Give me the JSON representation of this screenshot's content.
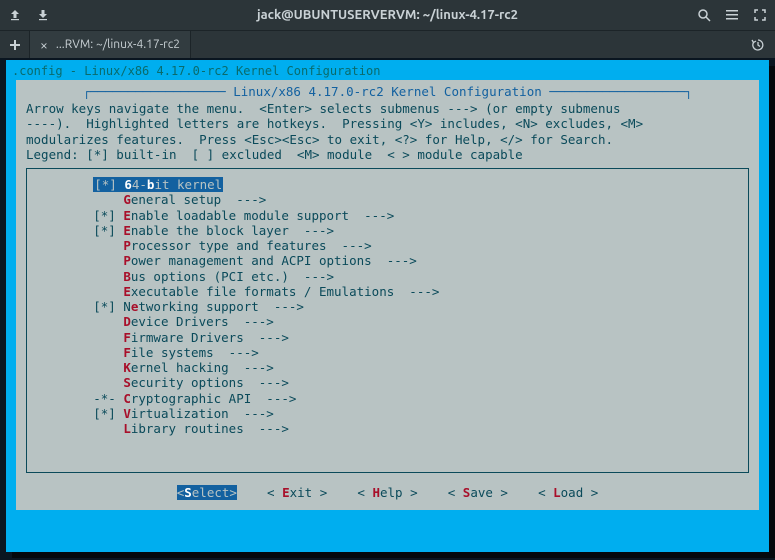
{
  "window": {
    "title": "jack@UBUNTUSERVERVM: ~/linux-4.17-rc2",
    "tab_label": "...RVM: ~/linux-4.17-rc2"
  },
  "config_header": ".config - Linux/x86 4.17.0-rc2 Kernel Configuration",
  "dialog": {
    "title": " Linux/x86 4.17.0-rc2 Kernel Configuration ",
    "help1": "Arrow keys navigate the menu.  <Enter> selects submenus ---> (or empty submenus",
    "help2": "----).  Highlighted letters are hotkeys.  Pressing <Y> includes, <N> excludes, <M>",
    "help3": "modularizes features.  Press <Esc><Esc> to exit, <?> for Help, </> for Search.",
    "help4": "Legend: [*] built-in  [ ] excluded  <M> module  < > module capable"
  },
  "menu": [
    {
      "prefix": "[*] ",
      "hot": "6",
      "pre": "4-",
      "hot2": "b",
      "rest": "it kernel",
      "suffix": "",
      "selected": true
    },
    {
      "prefix": "    ",
      "hot": "G",
      "rest": "eneral setup  --->",
      "selected": false
    },
    {
      "prefix": "[*] ",
      "hot": "E",
      "rest": "nable loadable module support  --->",
      "selected": false
    },
    {
      "prefix": "[*] ",
      "hot": "E",
      "rest": "nable the block layer  --->",
      "selected": false
    },
    {
      "prefix": "    ",
      "hot": "P",
      "rest": "rocessor type and features  --->",
      "selected": false
    },
    {
      "prefix": "    ",
      "hot": "P",
      "rest": "ower management and ACPI options  --->",
      "selected": false
    },
    {
      "prefix": "    ",
      "hot": "B",
      "rest": "us options (PCI etc.)  --->",
      "selected": false
    },
    {
      "prefix": "    ",
      "hot": "E",
      "rest": "xecutable file formats / Emulations  --->",
      "selected": false
    },
    {
      "prefix": "[*] N",
      "hot": "e",
      "rest": "tworking support  --->",
      "selected": false
    },
    {
      "prefix": "    ",
      "hot": "D",
      "rest": "evice Drivers  --->",
      "selected": false
    },
    {
      "prefix": "    ",
      "hot": "F",
      "rest": "irmware Drivers  --->",
      "selected": false
    },
    {
      "prefix": "    ",
      "hot": "F",
      "rest": "ile systems  --->",
      "selected": false
    },
    {
      "prefix": "    ",
      "hot": "K",
      "rest": "ernel hacking  --->",
      "selected": false
    },
    {
      "prefix": "    ",
      "hot": "S",
      "rest": "ecurity options  --->",
      "selected": false
    },
    {
      "prefix": "-*- ",
      "hot": "C",
      "rest": "ryptographic API  --->",
      "selected": false
    },
    {
      "prefix": "[*] ",
      "hot": "V",
      "rest": "irtualization  --->",
      "selected": false
    },
    {
      "prefix": "    ",
      "hot": "L",
      "rest": "ibrary routines  --->",
      "selected": false
    }
  ],
  "buttons": {
    "select": {
      "hot": "S",
      "rest": "elect",
      "selected": true
    },
    "exit": {
      "hot": "E",
      "rest": "xit",
      "selected": false
    },
    "help": {
      "hot": "H",
      "rest": "elp",
      "selected": false
    },
    "save": {
      "hot": "S",
      "rest": "ave",
      "selected": false
    },
    "load": {
      "hot": "L",
      "rest": "oad",
      "selected": false
    }
  }
}
